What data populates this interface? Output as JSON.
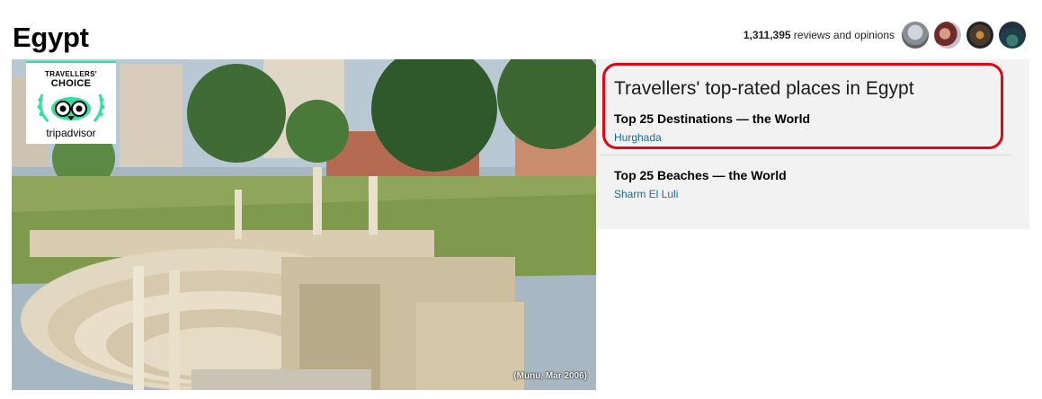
{
  "page": {
    "title": "Egypt"
  },
  "reviews": {
    "count": "1,311,395",
    "text": "reviews and opinions"
  },
  "hero": {
    "badge_line1": "TRAVELLERS'",
    "badge_line2": "CHOICE",
    "badge_brand": "tripadvisor",
    "credit": "(Munu, Mar 2006)"
  },
  "panel": {
    "title": "Travellers' top-rated places in Egypt",
    "awards": [
      {
        "title": "Top 25 Destinations — the World",
        "link": "Hurghada"
      },
      {
        "title": "Top 25 Beaches — the World",
        "link": "Sharm El Luli"
      }
    ]
  },
  "colors": {
    "highlight_border": "#e30613",
    "link": "#1a6aa0",
    "panel_background": "#f2f2f2",
    "badge_accent": "#34e0a1"
  },
  "icons": [
    "avatar-photo",
    "tripadvisor-owl-icon"
  ]
}
